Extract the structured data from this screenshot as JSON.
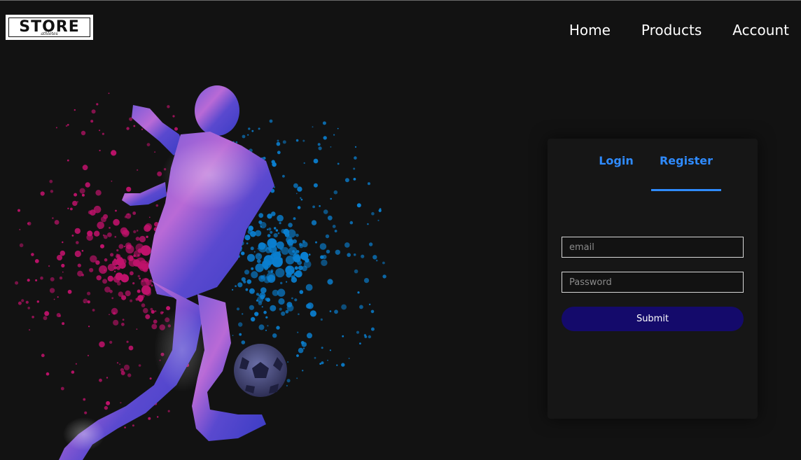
{
  "logo": {
    "main": "STORE",
    "sub": "athletes"
  },
  "nav": {
    "items": [
      "Home",
      "Products",
      "Account"
    ]
  },
  "auth": {
    "tabs": [
      "Login",
      "Register"
    ],
    "active_tab": "Register",
    "email_placeholder": "email",
    "password_placeholder": "Password",
    "submit_label": "Submit"
  },
  "colors": {
    "background": "#121212",
    "accent": "#2f8bff",
    "submit": "#140a6b",
    "splash_pink": "#c0126b",
    "splash_blue": "#0a7fd0"
  }
}
